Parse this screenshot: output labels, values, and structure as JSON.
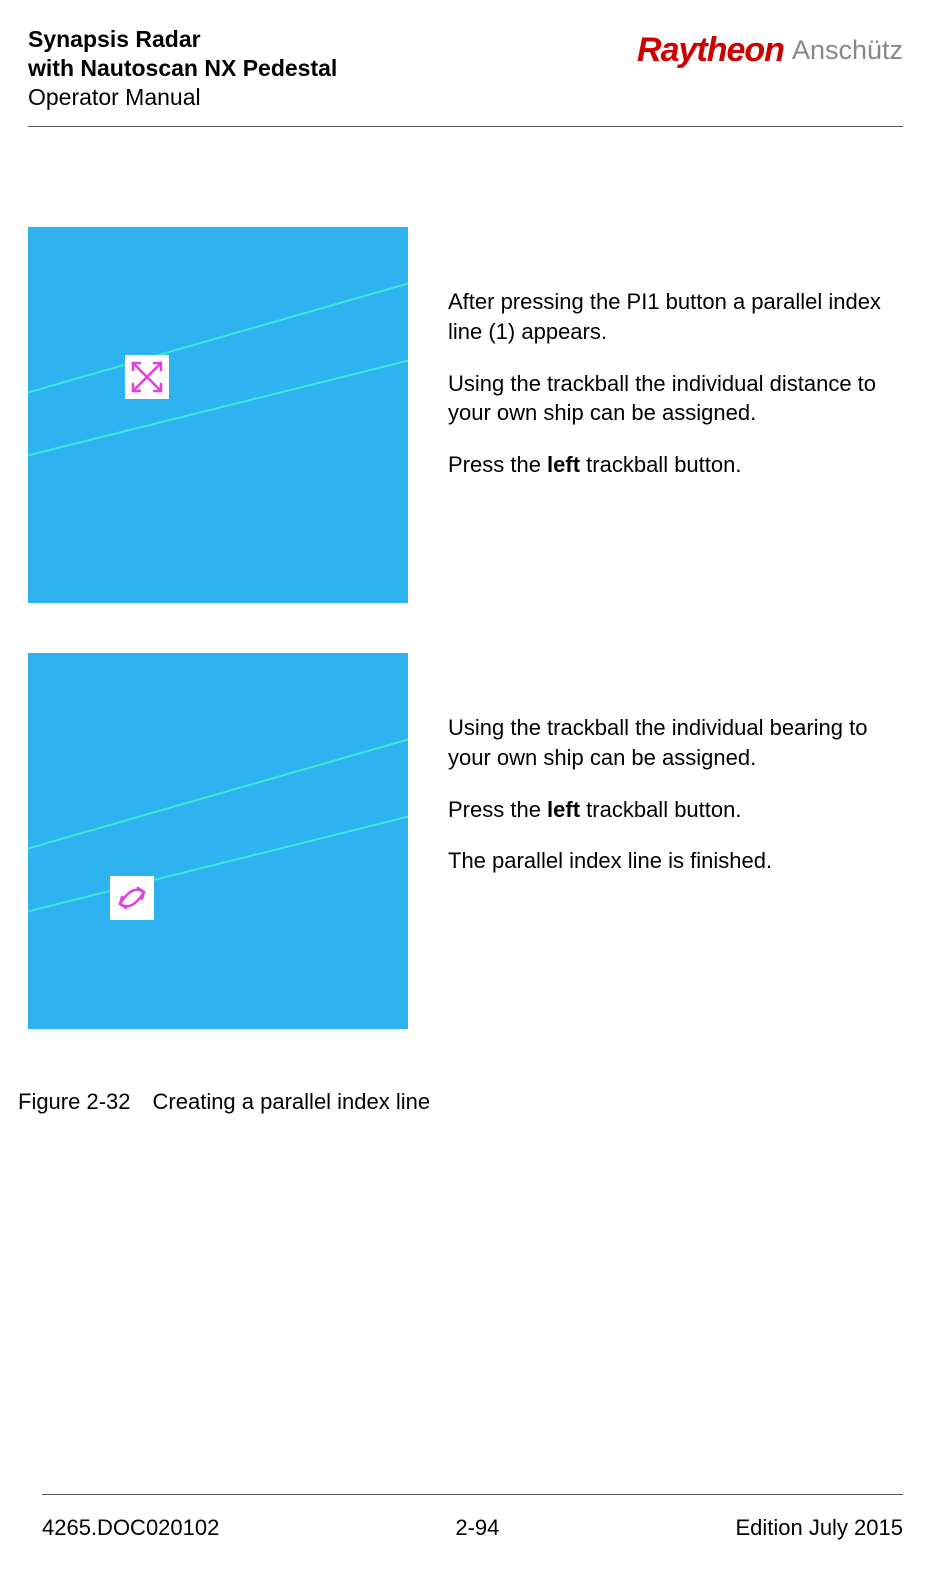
{
  "header": {
    "product_line1": "Synapsis Radar",
    "product_line2": "with Nautoscan NX Pedestal",
    "doc_type": "Operator Manual",
    "brand1": "Raytheon",
    "brand2": "Anschütz"
  },
  "block1": {
    "p1_a": "After pressing the PI1 button a parallel index line (1) appears.",
    "p2_a": "Using the trackball the individual distance to your own ship can be assigned.",
    "p3_prefix": "Press the ",
    "p3_bold": "left",
    "p3_suffix": " trackball button."
  },
  "block2": {
    "p1": "Using the trackball the individual bearing to your own ship can be assigned.",
    "p2_prefix": "Press the ",
    "p2_bold": "left",
    "p2_suffix": " trackball button.",
    "p3": "The parallel index line is finished."
  },
  "figure": {
    "number": "Figure 2-32",
    "title": "Creating a parallel index line"
  },
  "footer": {
    "doc_id": "4265.DOC020102",
    "page_num": "2-94",
    "edition": "Edition July 2015"
  }
}
